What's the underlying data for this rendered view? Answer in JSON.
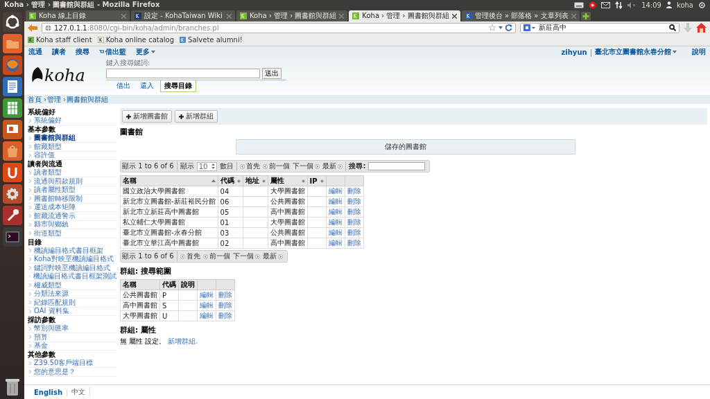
{
  "window": {
    "title": "Koha › 管理 › 圖書館與群組 - Mozilla Firefox"
  },
  "system_tray": {
    "time": "14:09",
    "user": "koha"
  },
  "tabs": [
    {
      "label": "Koha 線上目錄",
      "selected": false,
      "kind": "koha"
    },
    {
      "label": "設定 - KohaTaiwan Wiki",
      "selected": false,
      "kind": "wiki"
    },
    {
      "label": "Koha › 管理 › 圖書館與群組",
      "selected": false,
      "kind": "koha"
    },
    {
      "label": "Koha › 管理 › 圖書館與群組",
      "selected": true,
      "kind": "koha"
    },
    {
      "label": "管理後台 » 部落格 » 文章列表",
      "selected": false,
      "kind": "blog"
    }
  ],
  "address_bar": {
    "host": "127.0.1.1",
    "path": ":8080/cgi-bin/koha/admin/branches.pl"
  },
  "search_bar": {
    "value": "新莊高中"
  },
  "bookmarks": [
    {
      "label": "Koha staff client",
      "kind": "koha"
    },
    {
      "label": "Koha online catalog",
      "kind": "koha2"
    },
    {
      "label": "Salvete alumni!",
      "kind": "page"
    }
  ],
  "top_nav": {
    "items": [
      "流通",
      "讀者",
      "搜尋",
      "借出籃",
      "更多"
    ],
    "user": "zihyun",
    "separator": "|",
    "branch": "臺北市立圖書館永春分館",
    "help": "說明"
  },
  "logo": "koha",
  "search": {
    "label": "鍵入搜尋鍵詞:",
    "button": "送出",
    "tabs": [
      {
        "label": "借出",
        "selected": false
      },
      {
        "label": "還入",
        "selected": false
      },
      {
        "label": "搜尋目錄",
        "selected": true
      }
    ]
  },
  "breadcrumb": [
    "首頁",
    "管理",
    "圖書館與群組"
  ],
  "breadcrumb_separators": [
    "›",
    "›"
  ],
  "sidebar": [
    {
      "heading": "系統偏好",
      "items": [
        {
          "label": "系統偏好",
          "selected": false
        }
      ]
    },
    {
      "heading": "基本參數",
      "items": [
        {
          "label": "圖書館與群組",
          "selected": true
        },
        {
          "label": "館藏類型",
          "selected": false
        },
        {
          "label": "容許值",
          "selected": false
        }
      ]
    },
    {
      "heading": "讀者與流通",
      "items": [
        {
          "label": "讀者類型",
          "selected": false
        },
        {
          "label": "流通與罰款規則",
          "selected": false
        },
        {
          "label": "讀者屬性類型",
          "selected": false
        },
        {
          "label": "圖書館轉移限制",
          "selected": false
        },
        {
          "label": "運送成本矩陣",
          "selected": false
        },
        {
          "label": "館藏流通警示",
          "selected": false
        },
        {
          "label": "縣市與鄉鎮",
          "selected": false
        },
        {
          "label": "街道類型",
          "selected": false
        }
      ]
    },
    {
      "heading": "目錄",
      "items": [
        {
          "label": "機讀編目格式書目框架",
          "selected": false
        },
        {
          "label": "Koha對映至機讀編目格式",
          "selected": false
        },
        {
          "label": "鍵詞對映至機讀編目格式",
          "selected": false
        },
        {
          "label": "機讀編目格式書目框架測試",
          "selected": false
        },
        {
          "label": "權威類型",
          "selected": false
        },
        {
          "label": "分類法來源",
          "selected": false
        },
        {
          "label": "紀錄匹配規則",
          "selected": false
        },
        {
          "label": "OAI 資料集",
          "selected": false
        }
      ]
    },
    {
      "heading": "採訪參數",
      "items": [
        {
          "label": "幣別與匯率",
          "selected": false
        },
        {
          "label": "預算",
          "selected": false
        },
        {
          "label": "基金",
          "selected": false
        }
      ]
    },
    {
      "heading": "其他參數",
      "items": [
        {
          "label": "Z39.50客戶端目標",
          "selected": false
        },
        {
          "label": "您的意思是？",
          "selected": false
        }
      ]
    }
  ],
  "toolbar": [
    "新增圖書館",
    "新增群組"
  ],
  "libraries": {
    "title": "圖書館",
    "saved_label": "儲存的圖書館",
    "info": "顯示 1 to 6 of 6",
    "show_label": "顯示",
    "page_size": "10",
    "entries_label": "數目",
    "pager": [
      "首先",
      "前一個",
      "下一個",
      "最新"
    ],
    "search_label": "搜尋:",
    "columns": [
      "名稱",
      "代碼",
      "地址",
      "屬性",
      "IP"
    ],
    "rows": [
      {
        "name": "國立政治大學圖書館",
        "code": "04",
        "category": "大學圖書館",
        "edit": "編輯",
        "delete": "刪除"
      },
      {
        "name": "新北市立圖書館-新莊裕民分館",
        "code": "06",
        "category": "公共圖書館",
        "edit": "編輯",
        "delete": "刪除"
      },
      {
        "name": "新北市立新莊高中圖書館",
        "code": "05",
        "category": "高中圖書館",
        "edit": "編輯",
        "delete": "刪除"
      },
      {
        "name": "私立輔仁大學圖書館",
        "code": "01",
        "category": "大學圖書館",
        "edit": "編輯",
        "delete": "刪除"
      },
      {
        "name": "臺北市立圖書館-永春分館",
        "code": "03",
        "category": "公共圖書館",
        "edit": "編輯",
        "delete": "刪除"
      },
      {
        "name": "臺北市立華江高中圖書館",
        "code": "02",
        "category": "高中圖書館",
        "edit": "編輯",
        "delete": "刪除"
      }
    ],
    "bottom_info": "顯示 1 to 6 of 6",
    "bottom_pager": [
      "首先",
      "前一個",
      "下一個",
      "最新"
    ]
  },
  "search_groups": {
    "title": "群組: 搜尋範圍",
    "columns": [
      "名稱",
      "代碼",
      "說明"
    ],
    "rows": [
      {
        "name": "公共圖書館",
        "code": "P",
        "edit": "編輯",
        "delete": "刪除"
      },
      {
        "name": "高中圖書館",
        "code": "S",
        "edit": "編輯",
        "delete": "刪除"
      },
      {
        "name": "大學圖書館",
        "code": "U",
        "edit": "編輯",
        "delete": "刪除"
      }
    ]
  },
  "property_groups": {
    "title": "群組: 屬性",
    "text": "無 屬性 設定。",
    "link": "新增群組."
  },
  "languages": [
    {
      "label": "English",
      "selected": true
    },
    {
      "label": "中文",
      "selected": false
    }
  ]
}
